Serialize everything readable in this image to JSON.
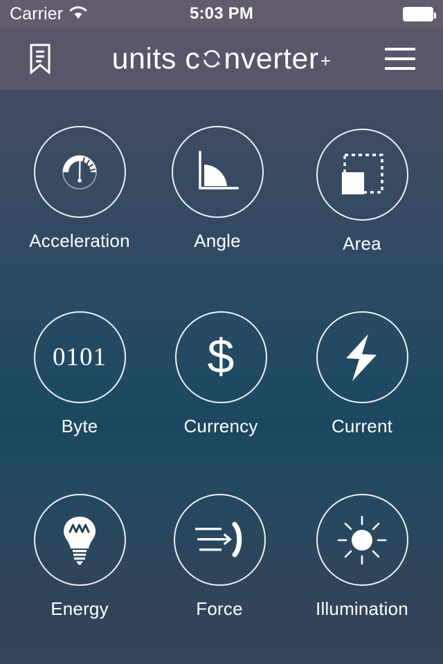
{
  "status_bar": {
    "carrier": "Carrier",
    "wifi_icon": "wifi-icon",
    "time": "5:03 PM",
    "battery_icon": "battery-full-icon"
  },
  "nav_bar": {
    "bookmark_icon": "bookmark-icon",
    "menu_icon": "hamburger-menu-icon",
    "title_part1": "units c",
    "title_sync_icon": "sync-arrows-icon",
    "title_part2": "nverter",
    "title_plus": "+",
    "title_full": "units converter+"
  },
  "grid": {
    "items": [
      {
        "label": "Acceleration",
        "icon": "speedometer-icon"
      },
      {
        "label": "Angle",
        "icon": "angle-icon"
      },
      {
        "label": "Area",
        "icon": "area-squares-icon"
      },
      {
        "label": "Byte",
        "icon": "binary-0101-icon",
        "icon_text": "0101"
      },
      {
        "label": "Currency",
        "icon": "dollar-sign-icon",
        "icon_text": "$"
      },
      {
        "label": "Current",
        "icon": "lightning-bolt-icon"
      },
      {
        "label": "Energy",
        "icon": "light-bulb-icon"
      },
      {
        "label": "Force",
        "icon": "force-arrow-icon"
      },
      {
        "label": "Illumination",
        "icon": "sun-icon"
      }
    ]
  },
  "colors": {
    "status_bar_bg": "#635c6c",
    "nav_bar_bg": "#5a5568",
    "gradient_top": "#4b4560",
    "gradient_mid": "#1b4760",
    "gradient_bottom": "#36445c",
    "text": "#ffffff"
  }
}
